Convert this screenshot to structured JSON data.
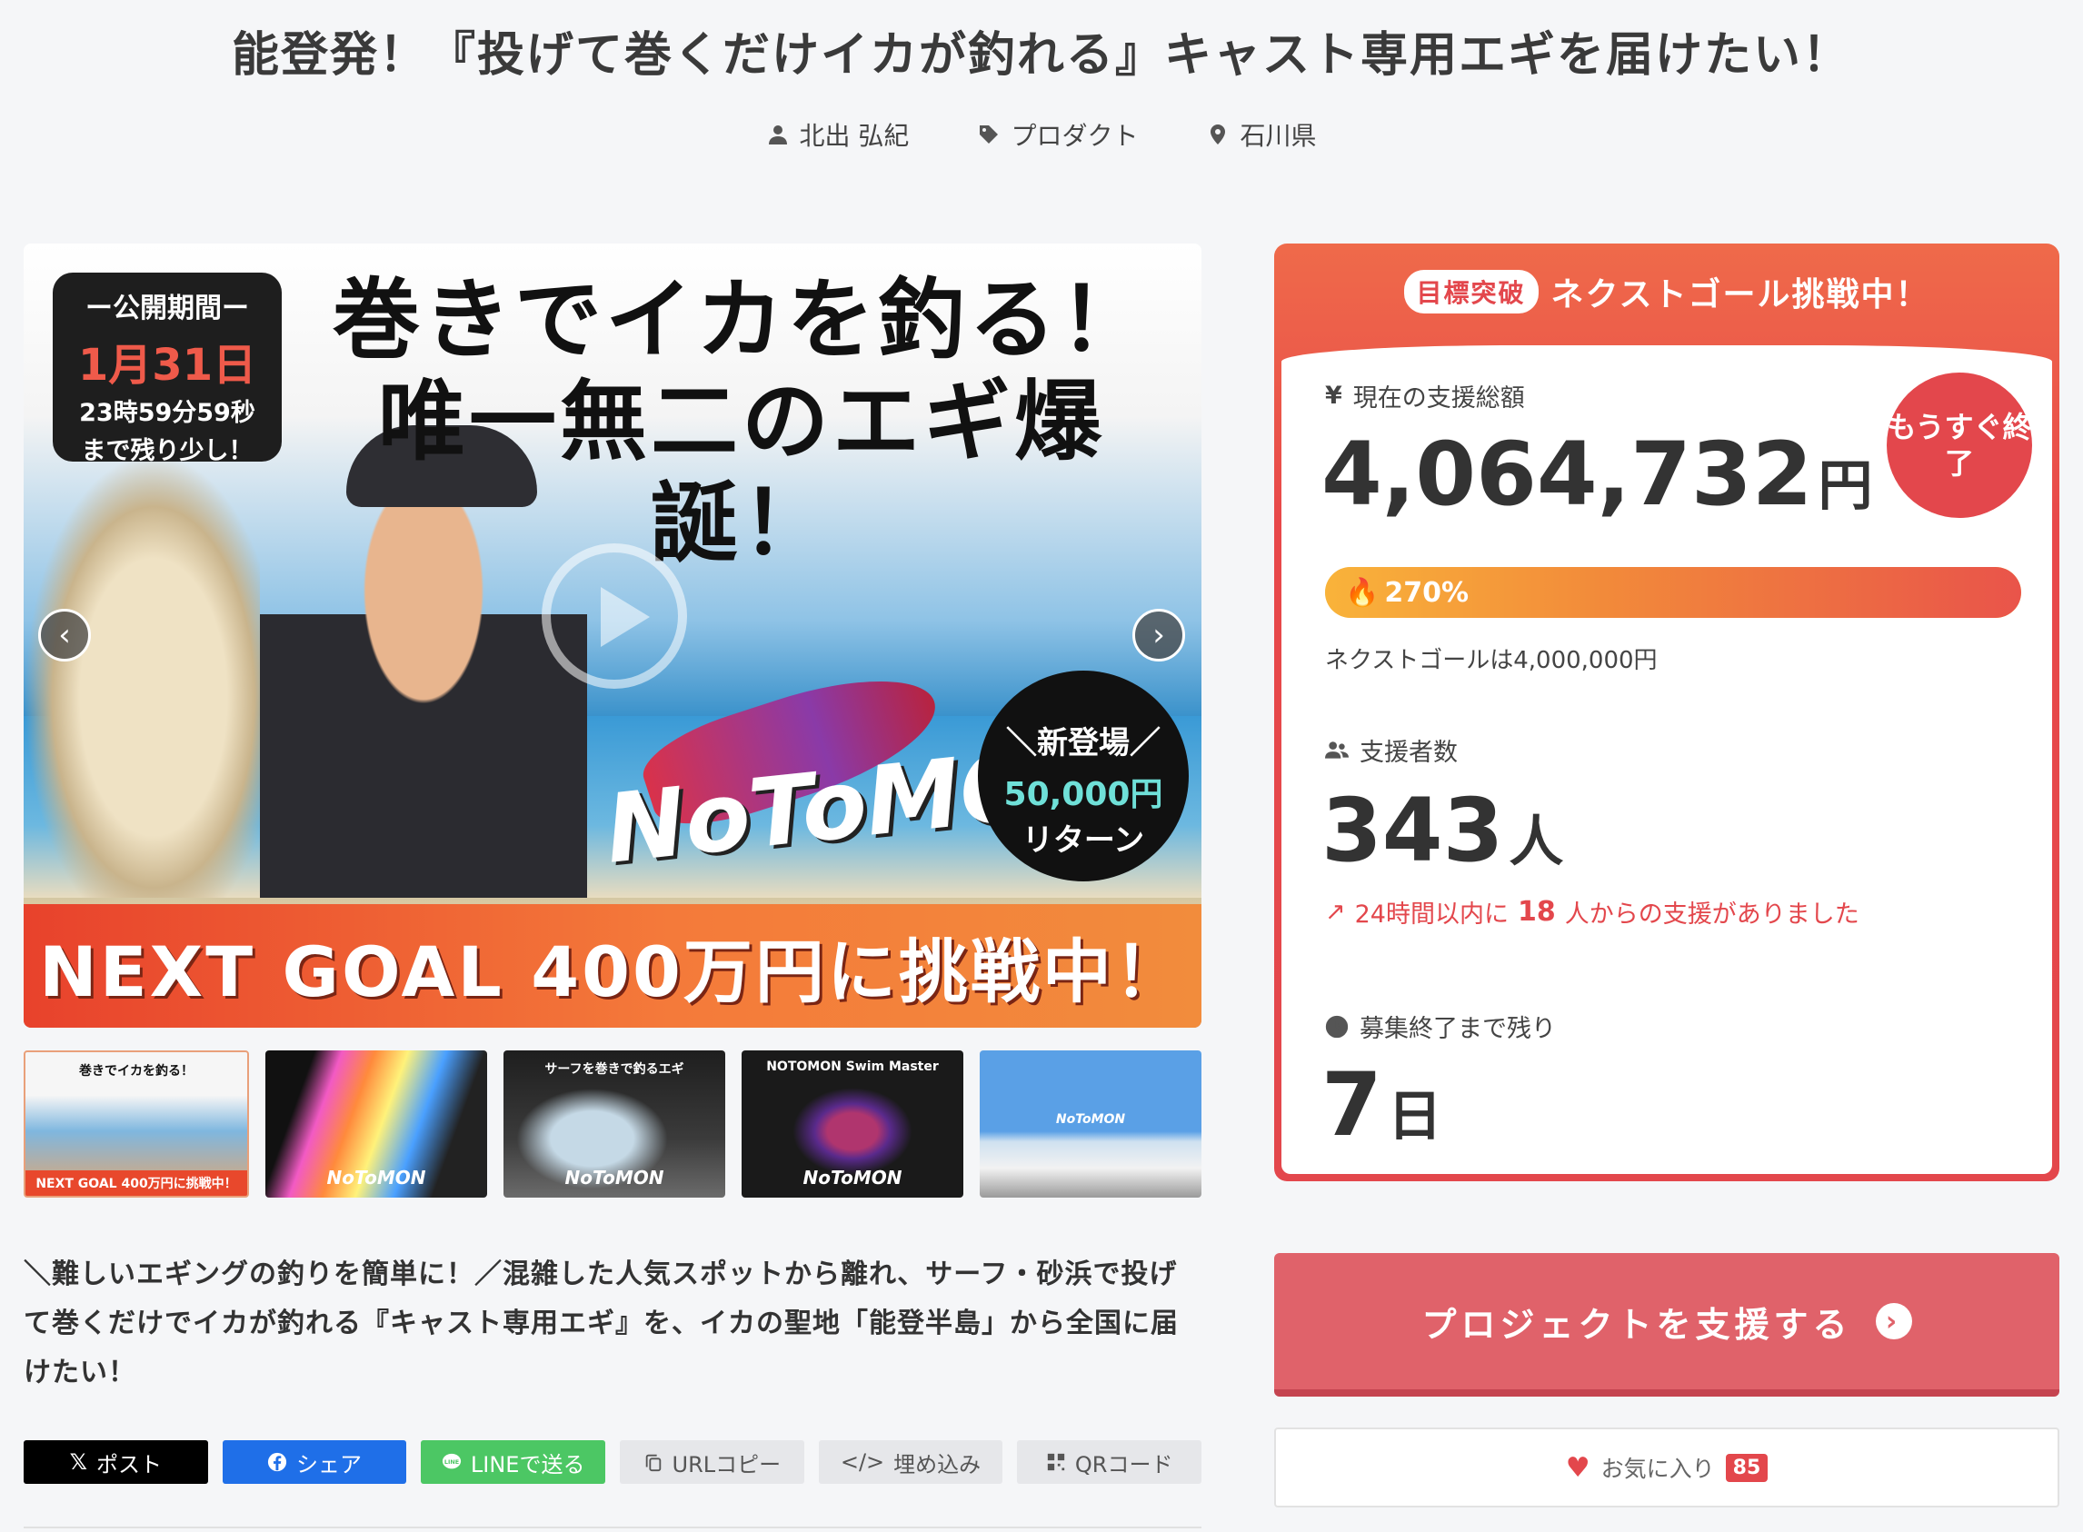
{
  "project": {
    "title": "能登発！『投げて巻くだけイカが釣れる』キャスト専用エギを届けたい！",
    "author": "北出 弘紀",
    "category": "プロダクト",
    "location": "石川県"
  },
  "hero": {
    "period_label": "ー公開期間ー",
    "period_date": "1月31日",
    "period_time": "23時59分59秒",
    "period_note": "まで残り少し！",
    "headline_line1": "巻きでイカを釣る！",
    "headline_line2": "唯一無二のエギ爆誕！",
    "brand": "NoToMON",
    "bubble_line1": "＼新登場／",
    "bubble_line2": "50,000円",
    "bubble_line3": "リターン",
    "banner": "NEXT GOAL 400万円に挑戦中！"
  },
  "thumbnails": [
    {
      "label": "NEXT GOAL 400万円に挑戦中！",
      "top": "巻きでイカを釣る！"
    },
    {
      "label": "NoToMON",
      "top": ""
    },
    {
      "label": "NoToMON",
      "top": "サーフを巻きで釣るエギ"
    },
    {
      "label": "NoToMON",
      "top": "NOTOMON Swim Master"
    },
    {
      "label": "NoToMON",
      "top": ""
    }
  ],
  "description": "＼難しいエギングの釣りを簡単に！／混雑した人気スポットから離れ、サーフ・砂浜で投げて巻くだけでイカが釣れる『キャスト専用エギ』を、イカの聖地「能登半島」から全国に届けたい！",
  "share": {
    "x": "ポスト",
    "facebook": "シェア",
    "line": "LINEで送る",
    "url": "URLコピー",
    "embed": "埋め込み",
    "qr": "QRコード"
  },
  "panel": {
    "tag": "目標突破",
    "heading": "ネクストゴール挑戦中！",
    "soon": "もうすぐ終了",
    "amount_label": "現在の支援総額",
    "amount": "4,064,732",
    "amount_unit": "円",
    "percent": "270%",
    "percent_value": 270,
    "next_goal": "ネクストゴールは4,000,000円",
    "backers_label": "支援者数",
    "backers": "343",
    "backers_unit": "人",
    "recent_prefix": "24時間以内に",
    "recent_count": "18",
    "recent_suffix": "人からの支援がありました",
    "remaining_label": "募集終了まで残り",
    "remaining": "7",
    "remaining_unit": "日"
  },
  "cta": {
    "label": "プロジェクトを支援する"
  },
  "favorite": {
    "label": "お気に入り",
    "count": "85"
  },
  "colors": {
    "accent": "#e3474c",
    "cta": "#e0626a",
    "facebook": "#1f6fe8",
    "line": "#4cc764"
  }
}
